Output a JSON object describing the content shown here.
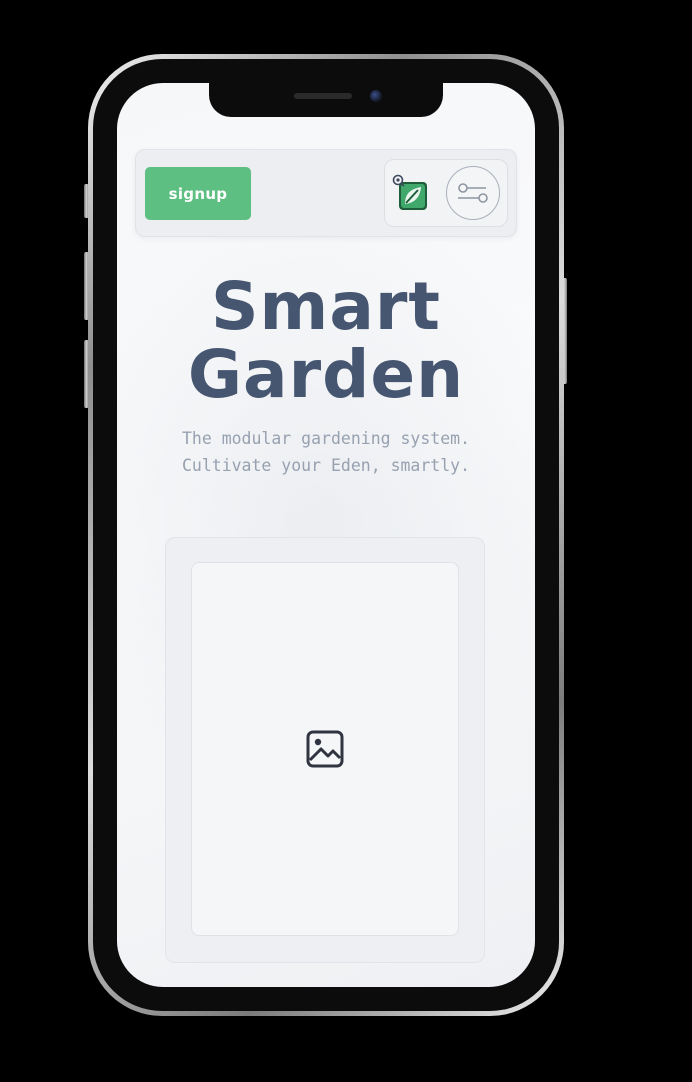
{
  "nav": {
    "signup_label": "signup",
    "logo_icon": "smart-garden-logo-icon",
    "toggle_icon": "toggle-switch-icon"
  },
  "hero": {
    "title_line1": "Smart",
    "title_line2": "Garden",
    "subtitle_line1": "The modular gardening system.",
    "subtitle_line2": "Cultivate your Eden, smartly."
  },
  "media": {
    "placeholder_icon": "image-placeholder-icon"
  },
  "colors": {
    "accent_green": "#5ebf82",
    "title_slate": "#475670",
    "subtitle_gray": "#97a1b0",
    "screen_bg": "#f7f8fa"
  }
}
